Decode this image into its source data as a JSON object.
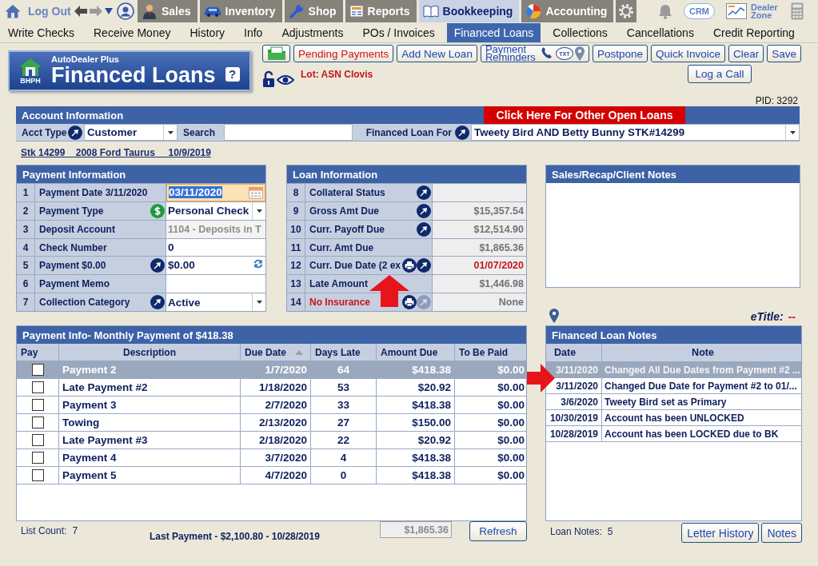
{
  "top_nav": {
    "logout": "Log Out",
    "tabs": [
      {
        "label": "Sales",
        "selected": false
      },
      {
        "label": "Inventory",
        "selected": false
      },
      {
        "label": "Shop",
        "selected": false
      },
      {
        "label": "Reports",
        "selected": false
      },
      {
        "label": "Bookkeeping",
        "selected": true
      },
      {
        "label": "Accounting",
        "selected": false
      }
    ],
    "crm": "CRM",
    "dealer_zone": "Dealer Zone"
  },
  "sub_nav": [
    {
      "label": "Write Checks",
      "selected": false
    },
    {
      "label": "Receive Money",
      "selected": false
    },
    {
      "label": "History",
      "selected": false
    },
    {
      "label": "Info",
      "selected": false
    },
    {
      "label": "Adjustments",
      "selected": false
    },
    {
      "label": "POs / Invoices",
      "selected": false
    },
    {
      "label": "Financed Loans",
      "selected": true
    },
    {
      "label": "Collections",
      "selected": false
    },
    {
      "label": "Cancellations",
      "selected": false
    },
    {
      "label": "Credit Reporting",
      "selected": false
    }
  ],
  "header": {
    "logo_label": "BHPH",
    "brand": "AutoDealer Plus",
    "title": "Financed Loans",
    "help": "?"
  },
  "toolbar": [
    {
      "kind": "icon"
    },
    {
      "kind": "alert",
      "label": "Pending Payments"
    },
    {
      "kind": "text",
      "label": "Add New Loan"
    },
    {
      "kind": "reminders",
      "label": "Payment Reminders",
      "badge": "TXT"
    },
    {
      "kind": "text",
      "label": "Postpone"
    },
    {
      "kind": "text",
      "label": "Quick Invoice"
    },
    {
      "kind": "text",
      "label": "Clear"
    },
    {
      "kind": "text",
      "label": "Save"
    }
  ],
  "lot": "Lot: ASN Clovis",
  "log_call": "Log a Call",
  "pid": "PID: 3292",
  "account": {
    "title": "Account Information",
    "other_loans": "Click Here For Other Open Loans",
    "acct_type_label": "Acct Type",
    "acct_type": "Customer",
    "search_label": "Search",
    "loan_for_label": "Financed Loan For",
    "loan_for": "Tweety Bird AND Betty Bunny STK#14299"
  },
  "vehicle": "Stk 14299    2008 Ford Taurus     10/9/2019",
  "payment_info": {
    "title": "Payment Information",
    "rows": [
      {
        "num": "1",
        "label": "Payment Date 3/11/2020",
        "kind": "date",
        "value": "03/11/2020"
      },
      {
        "num": "2",
        "label": "Payment Type",
        "kind": "method",
        "value": "Personal Check"
      },
      {
        "num": "3",
        "label": "Deposit Account",
        "kind": "readonly",
        "value": "1104 - Deposits in T"
      },
      {
        "num": "4",
        "label": "Check Number",
        "kind": "text",
        "value": "0"
      },
      {
        "num": "5",
        "label": "Payment $0.00",
        "kind": "amount",
        "value": "$0.00",
        "link": {
          "disabled": false
        }
      },
      {
        "num": "6",
        "label": "Payment Memo",
        "kind": "text"
      },
      {
        "num": "7",
        "label": "Collection Category",
        "kind": "select",
        "value": "Active",
        "link": {
          "disabled": false
        }
      }
    ]
  },
  "loan_info": {
    "title": "Loan Information",
    "rows": [
      {
        "num": "8",
        "label": "Collateral Status",
        "link": {
          "disabled": false
        },
        "print": false,
        "label_alert": false
      },
      {
        "num": "9",
        "label": "Gross Amt Due",
        "value": "$15,357.54",
        "link": {
          "disabled": false
        },
        "print": false,
        "label_alert": false,
        "value_alert": false
      },
      {
        "num": "10",
        "label": "Curr. Payoff Due",
        "value": "$12,514.90",
        "link": {
          "disabled": false
        },
        "print": false,
        "label_alert": false,
        "value_alert": false
      },
      {
        "num": "11",
        "label": "Curr. Amt Due",
        "value": "$1,865.36",
        "print": false,
        "label_alert": false,
        "value_alert": false
      },
      {
        "num": "12",
        "label": "Curr. Due Date (2 ex",
        "value": "01/07/2020",
        "link": {
          "disabled": false
        },
        "print": true,
        "label_alert": false,
        "value_alert": true
      },
      {
        "num": "13",
        "label": "Late Amount",
        "value": "$1,446.98",
        "print": false,
        "label_alert": false,
        "value_alert": false
      },
      {
        "num": "14",
        "label": "No Insurance",
        "value": "None",
        "link": {
          "disabled": true
        },
        "print": true,
        "label_alert": true,
        "value_alert": false
      }
    ]
  },
  "sales_notes": {
    "title": "Sales/Recap/Client Notes"
  },
  "etitle": {
    "label": "eTitle:",
    "value": "--"
  },
  "loan_notes": {
    "title": "Financed Loan Notes",
    "columns": [
      "Date",
      "Note"
    ],
    "rows": [
      {
        "date": "3/11/2020",
        "note": "Changed All Due Dates from Payment #2 ...",
        "selected": true
      },
      {
        "date": "3/11/2020",
        "note": "Changed Due Date for Payment #2 to 01/...",
        "selected": false
      },
      {
        "date": "3/6/2020",
        "note": "Tweety Bird set as Primary",
        "selected": false
      },
      {
        "date": "10/30/2019",
        "note": "Account has been UNLOCKED",
        "selected": false
      },
      {
        "date": "10/28/2019",
        "note": "Account has been LOCKED due to BK",
        "selected": false
      }
    ],
    "count_label": "Loan Notes:",
    "count": "5",
    "buttons": [
      "Letter History",
      "Notes"
    ]
  },
  "payments": {
    "title": "Payment Info- Monthly Payment of $418.38",
    "columns": [
      {
        "label": "Pay",
        "sorted": false
      },
      {
        "label": "Description",
        "sorted": false
      },
      {
        "label": "Due Date",
        "sorted": true
      },
      {
        "label": "Days Late",
        "sorted": false
      },
      {
        "label": "Amount Due",
        "sorted": false
      },
      {
        "label": "To Be Paid",
        "sorted": false
      }
    ],
    "rows": [
      {
        "description": "Payment 2",
        "due": "1/7/2020",
        "days_late": "64",
        "amount": "$418.38",
        "to_pay": "$0.00",
        "selected": true,
        "checked": false
      },
      {
        "description": "Late Payment #2",
        "due": "1/18/2020",
        "days_late": "53",
        "amount": "$20.92",
        "to_pay": "$0.00",
        "selected": false,
        "checked": false
      },
      {
        "description": "Payment 3",
        "due": "2/7/2020",
        "days_late": "33",
        "amount": "$418.38",
        "to_pay": "$0.00",
        "selected": false,
        "checked": false
      },
      {
        "description": "Towing",
        "due": "2/13/2020",
        "days_late": "27",
        "amount": "$150.00",
        "to_pay": "$0.00",
        "selected": false,
        "checked": false
      },
      {
        "description": "Late Payment #3",
        "due": "2/18/2020",
        "days_late": "22",
        "amount": "$20.92",
        "to_pay": "$0.00",
        "selected": false,
        "checked": false
      },
      {
        "description": "Payment 4",
        "due": "3/7/2020",
        "days_late": "4",
        "amount": "$418.38",
        "to_pay": "$0.00",
        "selected": false,
        "checked": false
      },
      {
        "description": "Payment 5",
        "due": "4/7/2020",
        "days_late": "0",
        "amount": "$418.38",
        "to_pay": "$0.00",
        "selected": false,
        "checked": false
      }
    ],
    "count_label": "List Count:",
    "count": "7",
    "last_payment": "Last Payment - $2,100.80 - 10/28/2019",
    "total": "$1,865.36",
    "refresh": "Refresh"
  }
}
